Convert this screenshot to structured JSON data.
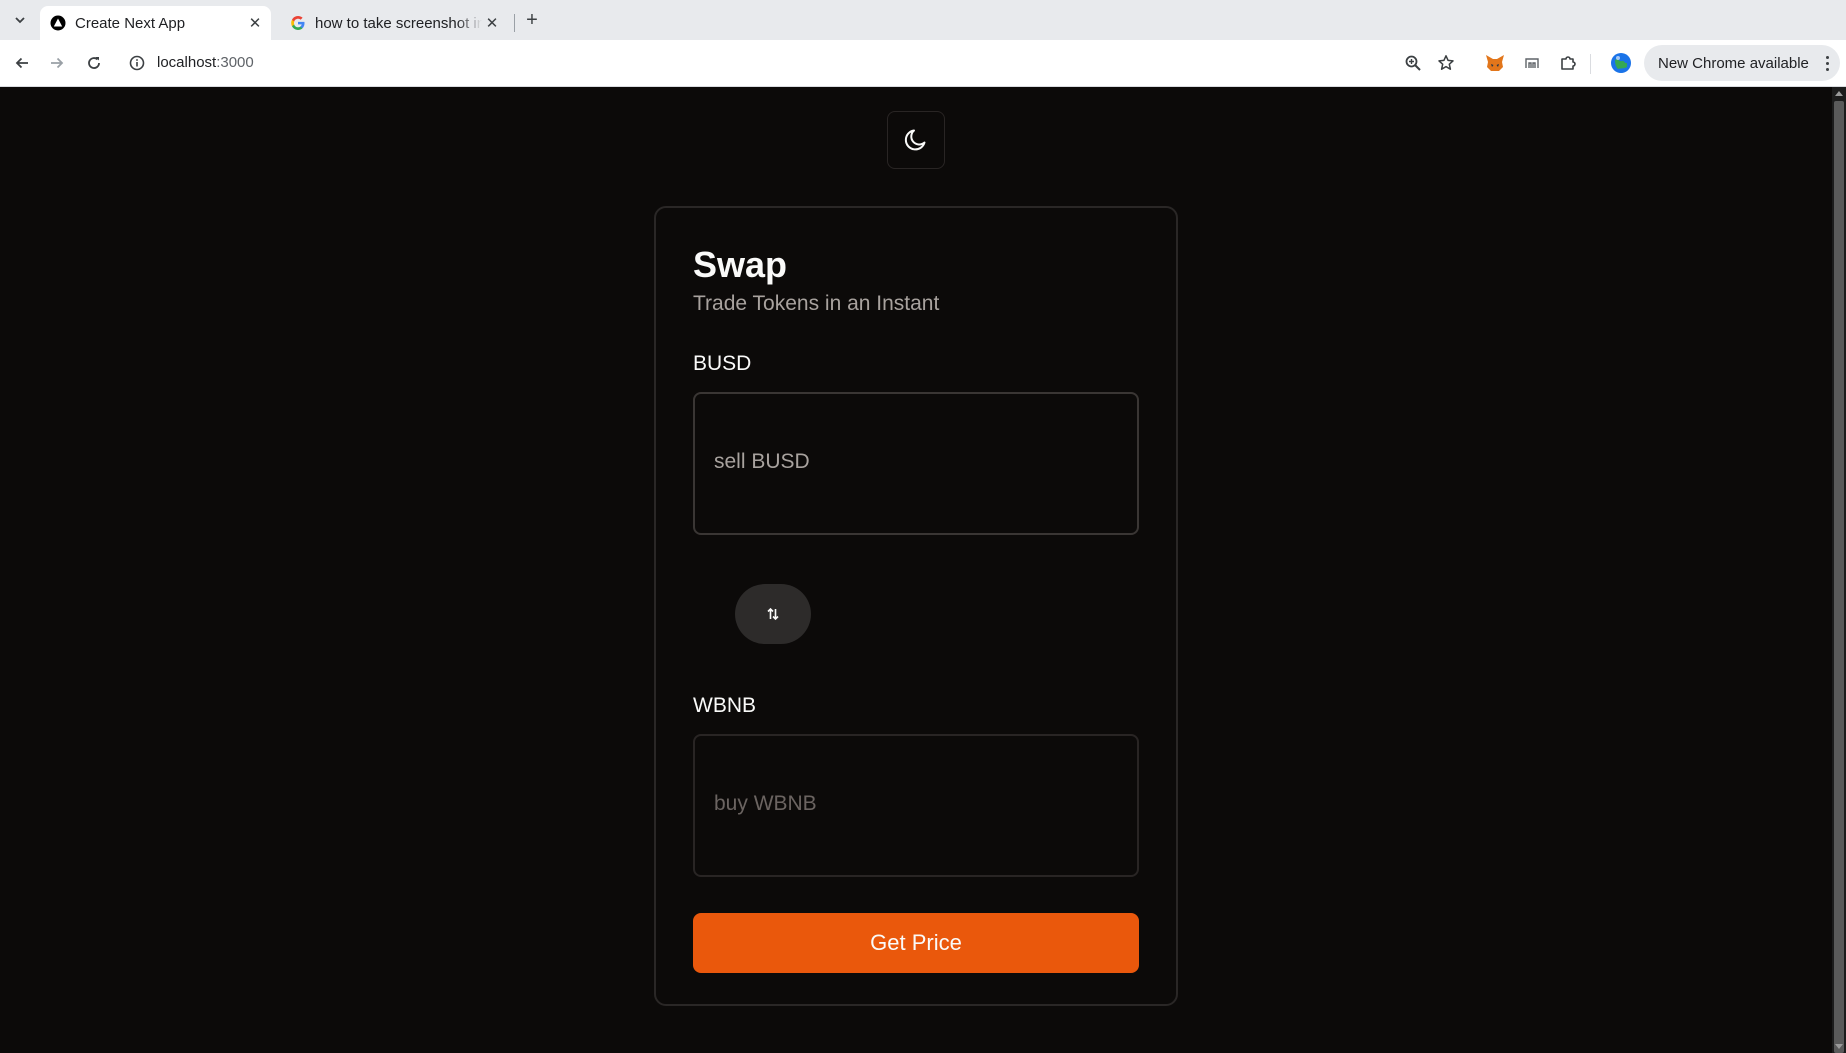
{
  "browser": {
    "tabs": [
      {
        "title": "Create Next App",
        "active": true
      },
      {
        "title": "how to take screenshot in",
        "active": false
      }
    ],
    "address_bar": {
      "host": "localhost",
      "port": ":3000"
    },
    "update_chip": "New Chrome available"
  },
  "icons": {
    "tab_menu": "chevron-down-icon",
    "tab1_favicon": "nextjs-logo-icon",
    "tab2_favicon": "google-logo-icon",
    "back": "arrow-left-icon",
    "forward": "arrow-right-icon",
    "reload": "reload-icon",
    "site_info": "info-icon",
    "zoom": "zoom-icon",
    "bookmark": "star-icon",
    "metamask": "metamask-fox-icon",
    "extension2": "extension-icon",
    "extensions": "puzzle-icon",
    "profile": "globe-avatar-icon",
    "theme": "moon-icon",
    "swap": "swap-arrows-icon"
  },
  "app": {
    "title": "Swap",
    "subtitle": "Trade Tokens in an Instant",
    "sell": {
      "label": "BUSD",
      "placeholder": "sell BUSD"
    },
    "buy": {
      "label": "WBNB",
      "placeholder": "buy WBNB"
    },
    "action": "Get Price"
  },
  "colors": {
    "background": "#0c0a09",
    "card_border": "#2a2726",
    "accent": "#ea580c",
    "text_primary": "#fafaf9",
    "text_muted": "#a8a29e"
  }
}
